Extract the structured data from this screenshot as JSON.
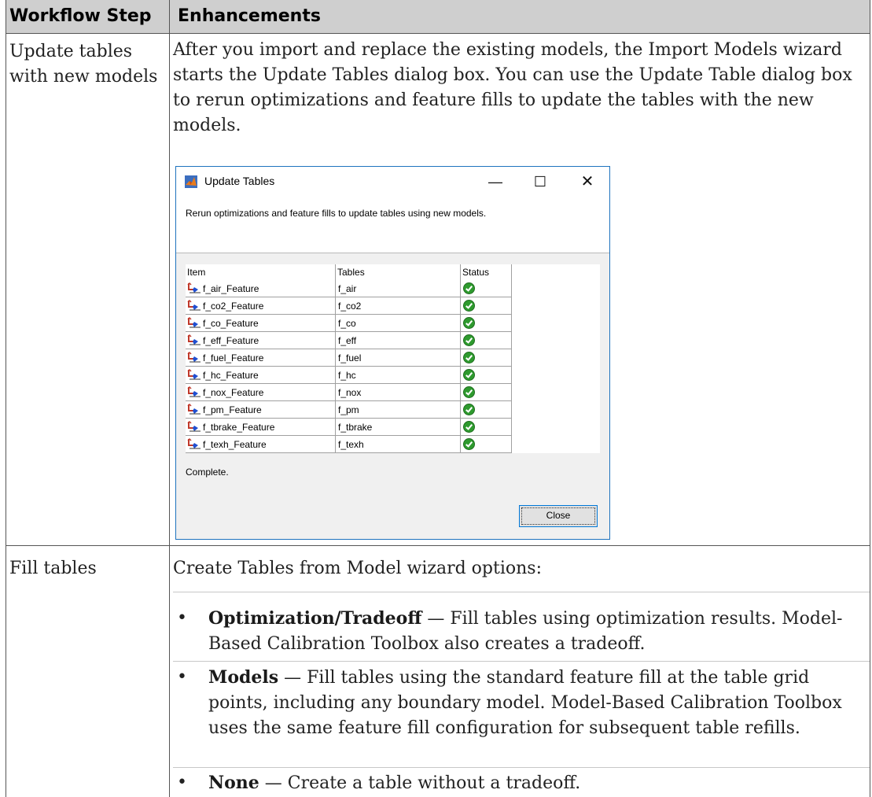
{
  "table": {
    "headers": [
      "Workflow Step",
      "Enhancements"
    ],
    "row1": {
      "step": "Update tables with new models",
      "text": "After you import and replace the existing models, the Import Models wizard starts the Update Tables dialog box. You can use the Update Table dialog box to rerun optimizations and feature fills to update the tables with the new models."
    },
    "row2": {
      "step": "Fill tables",
      "text": "Create Tables from Model wizard options:",
      "bullets": [
        {
          "keyword": "Optimization/Tradeoff",
          "text": " — Fill tables using optimization results. Model-Based Calibration Toolbox also creates a tradeoff."
        },
        {
          "keyword": "Models",
          "text": " — Fill tables using the standard feature fill at the table grid points, including any boundary model. Model-Based Calibration Toolbox uses the same feature fill configuration for subsequent table refills."
        },
        {
          "keyword": "None",
          "text": " — Create a table without a tradeoff."
        }
      ]
    }
  },
  "dialog": {
    "title": "Update Tables",
    "minimize": "—",
    "maximize": "☐",
    "close": "✕",
    "message": "Rerun optimizations and feature fills to update tables using new models.",
    "columns": [
      "Item",
      "Tables",
      "Status"
    ],
    "rows": [
      {
        "item": "f_air_Feature",
        "table": "f_air"
      },
      {
        "item": "f_co2_Feature",
        "table": "f_co2"
      },
      {
        "item": "f_co_Feature",
        "table": "f_co"
      },
      {
        "item": "f_eff_Feature",
        "table": "f_eff"
      },
      {
        "item": "f_fuel_Feature",
        "table": "f_fuel"
      },
      {
        "item": "f_hc_Feature",
        "table": "f_hc"
      },
      {
        "item": "f_nox_Feature",
        "table": "f_nox"
      },
      {
        "item": "f_pm_Feature",
        "table": "f_pm"
      },
      {
        "item": "f_tbrake_Feature",
        "table": "f_tbrake"
      },
      {
        "item": "f_texh_Feature",
        "table": "f_texh"
      }
    ],
    "status_icon": "check-circle-icon",
    "status_text": "Complete.",
    "close_button": "Close",
    "colors": {
      "check": "#2e9a2e",
      "border": "#1e73be"
    }
  }
}
